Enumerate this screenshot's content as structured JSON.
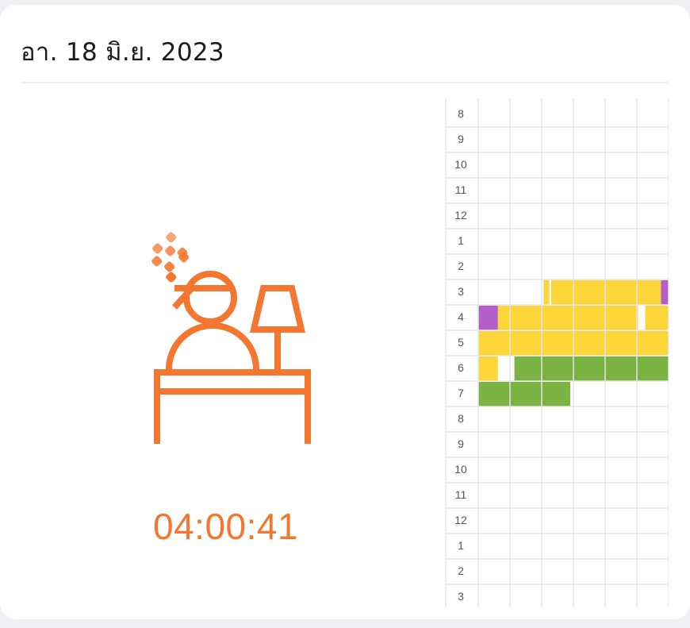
{
  "header": {
    "date": "อา. 18 มิ.ย. 2023"
  },
  "session": {
    "elapsed": "04:00:41",
    "illustration_icon": "sleeping-person-bed-lamp-icon",
    "accent_color": "#F5762F"
  },
  "sleep_chart": {
    "hour_labels": [
      "8",
      "9",
      "10",
      "11",
      "12",
      "1",
      "2",
      "3",
      "4",
      "5",
      "6",
      "7",
      "8",
      "9",
      "10",
      "11",
      "12",
      "1",
      "2",
      "3"
    ],
    "columns_per_hour": 6,
    "stage_colors": {
      "awake": "#B45FC8",
      "light": "#FFD63A",
      "deep": "#7BB342"
    },
    "segments": [
      {
        "row": 7,
        "start": 0.0,
        "end": 0.38,
        "stage": "none"
      },
      {
        "row": 7,
        "start": 2.06,
        "end": 2.24,
        "stage": "light"
      },
      {
        "row": 7,
        "start": 2.3,
        "end": 5.76,
        "stage": "light"
      },
      {
        "row": 7,
        "start": 5.76,
        "end": 6.0,
        "stage": "awake"
      },
      {
        "row": 8,
        "start": 0.0,
        "end": 0.62,
        "stage": "awake"
      },
      {
        "row": 8,
        "start": 0.62,
        "end": 5.04,
        "stage": "light"
      },
      {
        "row": 8,
        "start": 5.26,
        "end": 6.0,
        "stage": "light"
      },
      {
        "row": 9,
        "start": 0.0,
        "end": 6.0,
        "stage": "light"
      },
      {
        "row": 10,
        "start": 0.0,
        "end": 0.62,
        "stage": "light"
      },
      {
        "row": 10,
        "start": 1.14,
        "end": 6.0,
        "stage": "deep"
      },
      {
        "row": 11,
        "start": 0.0,
        "end": 2.9,
        "stage": "deep"
      }
    ]
  }
}
